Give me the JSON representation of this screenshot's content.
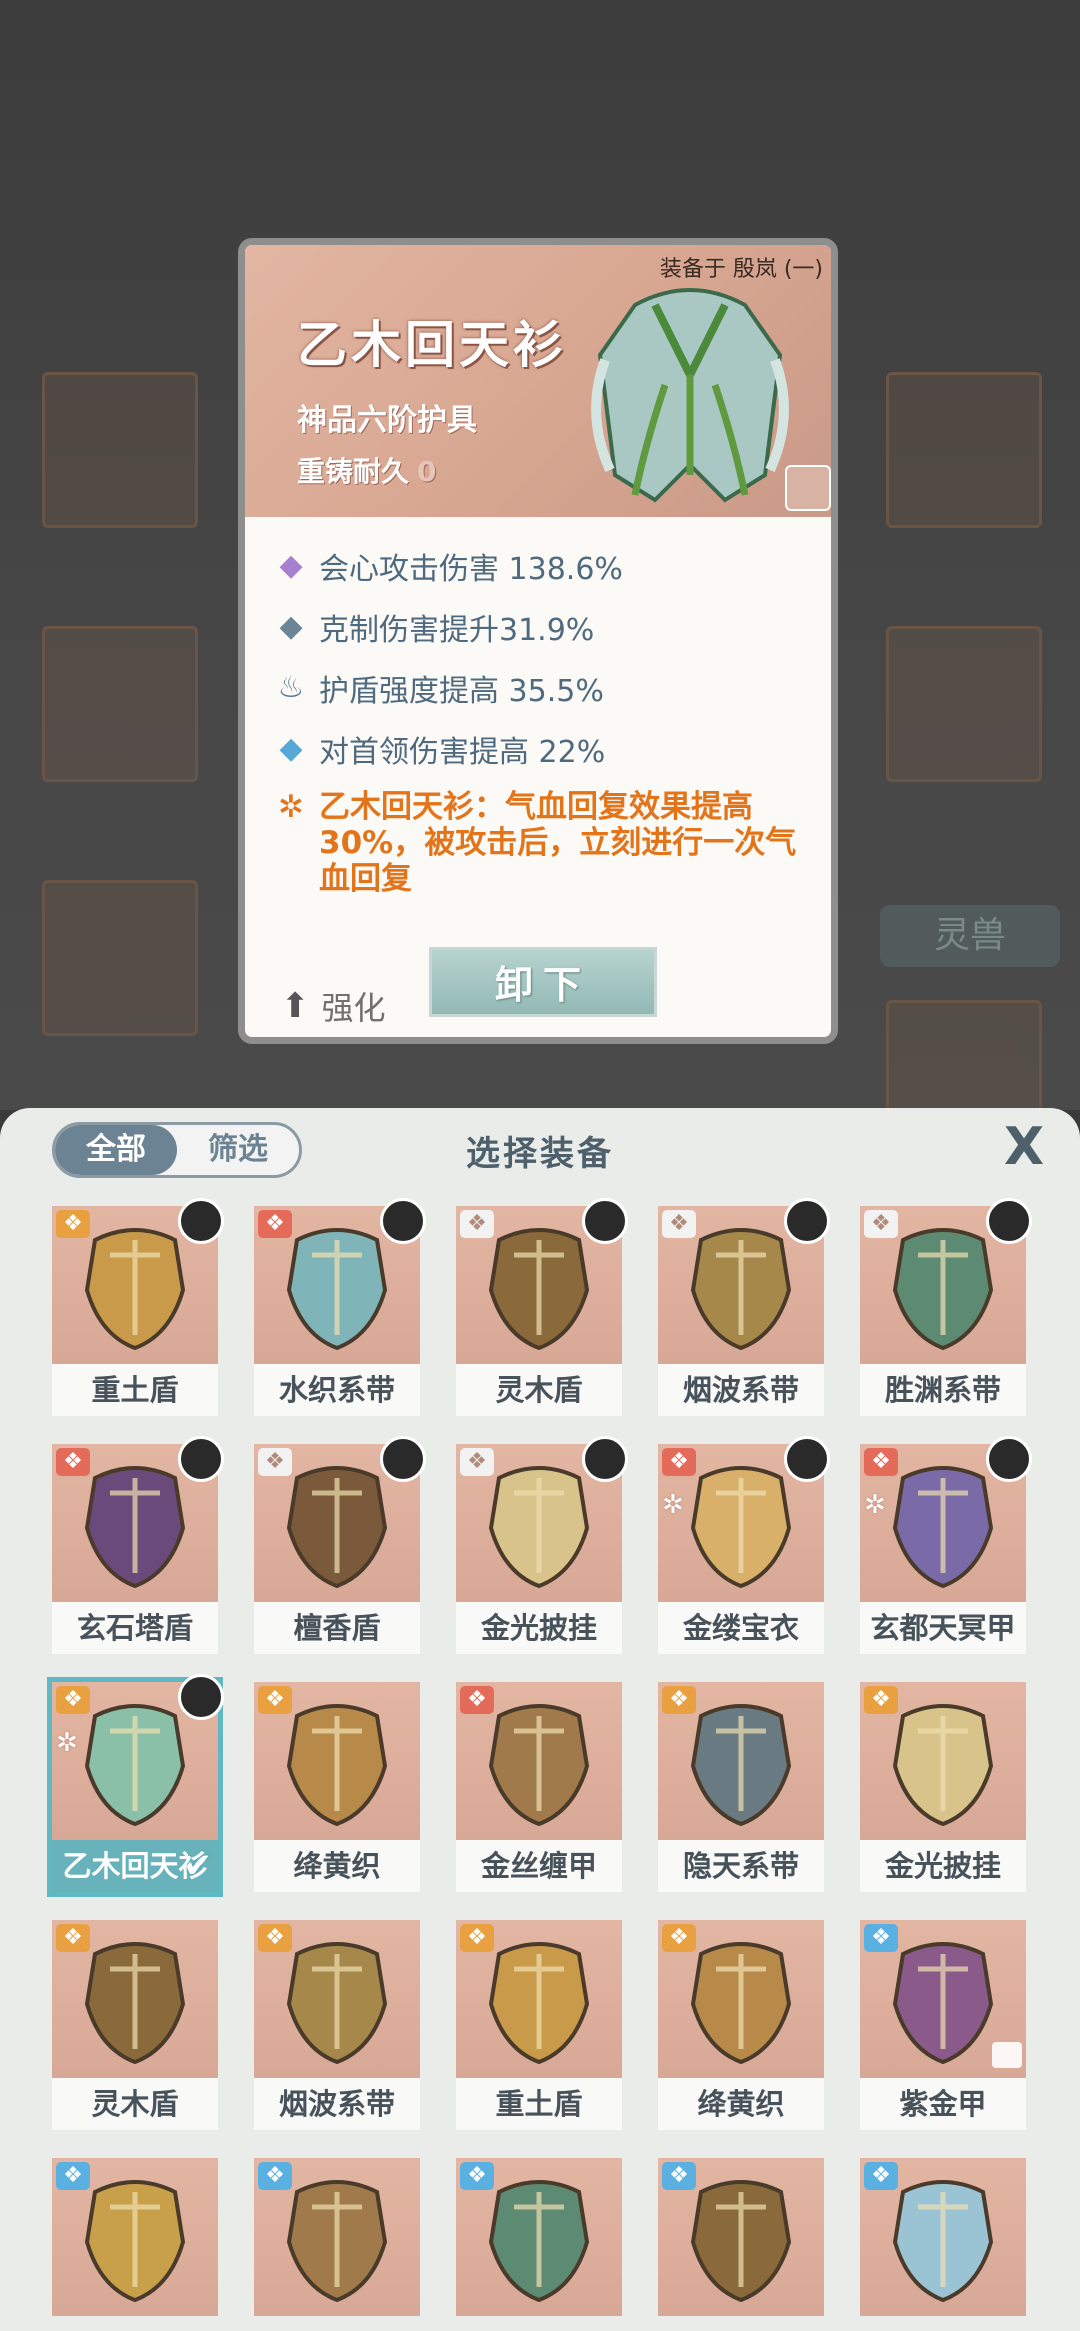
{
  "background": {
    "side_tag": "灵兽"
  },
  "detail": {
    "equipped_on": "装备于 殷岚 (一)",
    "name": "乙木回天衫",
    "grade": "神品六阶护具",
    "durability_label": "重铸耐久",
    "durability_value": "0",
    "attributes": [
      {
        "icon": "purple-diamond-icon",
        "color": "#a77fd0",
        "text": "会心攻击伤害 138.6%"
      },
      {
        "icon": "slate-diamond-icon",
        "color": "#6b8597",
        "text": "克制伤害提升31.9%"
      },
      {
        "icon": "shield-flame-icon",
        "color": "#5a7a92",
        "text": "护盾强度提高 35.5%"
      },
      {
        "icon": "blue-diamond-icon",
        "color": "#56a8d6",
        "text": "对首领伤害提高 22%"
      }
    ],
    "set_effect": "乙木回天衫：气血回复效果提高30%，被攻击后，立刻进行一次气血回复",
    "enhance_label": "强化",
    "unequip_label": "卸下"
  },
  "sheet": {
    "tab_all": "全部",
    "tab_filter": "筛选",
    "title": "选择装备",
    "close": "X",
    "items": [
      {
        "name": "重土盾",
        "type_color": "#e8a040",
        "avatar": true,
        "color": "#c99a4a"
      },
      {
        "name": "水织系带",
        "type_color": "#e46a5a",
        "avatar": true,
        "color": "#7fb4b8"
      },
      {
        "name": "灵木盾",
        "type_color": "#f2f2f2",
        "avatar": true,
        "color": "#8a6a3a"
      },
      {
        "name": "烟波系带",
        "type_color": "#f2f2f2",
        "avatar": true,
        "color": "#a6884a"
      },
      {
        "name": "胜渊系带",
        "type_color": "#f2f2f2",
        "avatar": true,
        "color": "#5d8a72"
      },
      {
        "name": "玄石塔盾",
        "type_color": "#e46a5a",
        "avatar": true,
        "color": "#6a4a7a"
      },
      {
        "name": "檀香盾",
        "type_color": "#f2f2f2",
        "avatar": true,
        "color": "#7a5a3a"
      },
      {
        "name": "金光披挂",
        "type_color": "#f2f2f2",
        "avatar": true,
        "color": "#d8c48a"
      },
      {
        "name": "金缕宝衣",
        "type_color": "#e46a5a",
        "avatar": true,
        "set": true,
        "color": "#d8b06a"
      },
      {
        "name": "玄都天冥甲",
        "type_color": "#e46a5a",
        "avatar": true,
        "set": true,
        "color": "#7a6aa8"
      },
      {
        "name": "乙木回天衫",
        "type_color": "#e8a040",
        "avatar": true,
        "set": true,
        "selected": true,
        "color": "#8ac0a8"
      },
      {
        "name": "绛黄织",
        "type_color": "#e8a040",
        "color": "#b88a4a"
      },
      {
        "name": "金丝缠甲",
        "type_color": "#e46a5a",
        "color": "#a07a4a"
      },
      {
        "name": "隐天系带",
        "type_color": "#e8a040",
        "color": "#6a7a82"
      },
      {
        "name": "金光披挂",
        "type_color": "#e8a040",
        "color": "#d8c48a"
      },
      {
        "name": "灵木盾",
        "type_color": "#e8a040",
        "color": "#8a6a3a"
      },
      {
        "name": "烟波系带",
        "type_color": "#e8a040",
        "color": "#a6884a"
      },
      {
        "name": "重土盾",
        "type_color": "#e8a040",
        "color": "#c99a4a"
      },
      {
        "name": "绛黄织",
        "type_color": "#e8a040",
        "color": "#b88a4a"
      },
      {
        "name": "紫金甲",
        "type_color": "#5ab0e0",
        "lock": true,
        "color": "#8a5a8a"
      },
      {
        "name": "",
        "type_color": "#5ab0e0",
        "color": "#c9a04a"
      },
      {
        "name": "",
        "type_color": "#5ab0e0",
        "color": "#a07a4a"
      },
      {
        "name": "",
        "type_color": "#5ab0e0",
        "color": "#5d8a72"
      },
      {
        "name": "",
        "type_color": "#5ab0e0",
        "color": "#8a6a3a"
      },
      {
        "name": "",
        "type_color": "#5ab0e0",
        "color": "#9ac4d4"
      }
    ]
  }
}
